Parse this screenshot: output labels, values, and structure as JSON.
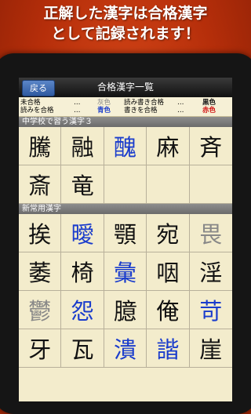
{
  "promo": {
    "line1": "正解した漢字は合格漢字",
    "line2": "として記録されます！"
  },
  "header": {
    "back_label": "戻る",
    "title": "合格漢字一覧"
  },
  "legend": [
    {
      "label": "未合格",
      "dots": "…",
      "color_name": "灰色",
      "color": "#888888"
    },
    {
      "label": "読み書き合格",
      "dots": "…",
      "color_name": "黒色",
      "color": "#111111"
    },
    {
      "label": "読みを合格",
      "dots": "…",
      "color_name": "青色",
      "color": "#1a3ccc"
    },
    {
      "label": "書きを合格",
      "dots": "…",
      "color_name": "赤色",
      "color": "#d01010"
    }
  ],
  "sections": [
    {
      "name": "中学校で習う漢字３",
      "kanji": [
        {
          "char": "騰",
          "color": "#111111"
        },
        {
          "char": "融",
          "color": "#111111"
        },
        {
          "char": "醜",
          "color": "#1a3ccc"
        },
        {
          "char": "麻",
          "color": "#111111"
        },
        {
          "char": "斉",
          "color": "#111111"
        },
        {
          "char": "斎",
          "color": "#111111"
        },
        {
          "char": "竜",
          "color": "#111111"
        }
      ]
    },
    {
      "name": "新常用漢字",
      "kanji": [
        {
          "char": "挨",
          "color": "#111111"
        },
        {
          "char": "曖",
          "color": "#1a3ccc"
        },
        {
          "char": "顎",
          "color": "#111111"
        },
        {
          "char": "宛",
          "color": "#111111"
        },
        {
          "char": "畏",
          "color": "#888888"
        },
        {
          "char": "萎",
          "color": "#111111"
        },
        {
          "char": "椅",
          "color": "#111111"
        },
        {
          "char": "彙",
          "color": "#1a3ccc"
        },
        {
          "char": "咽",
          "color": "#111111"
        },
        {
          "char": "淫",
          "color": "#111111"
        },
        {
          "char": "鬱",
          "color": "#888888"
        },
        {
          "char": "怨",
          "color": "#1a3ccc"
        },
        {
          "char": "臆",
          "color": "#111111"
        },
        {
          "char": "俺",
          "color": "#111111"
        },
        {
          "char": "苛",
          "color": "#1a3ccc"
        },
        {
          "char": "牙",
          "color": "#111111"
        },
        {
          "char": "瓦",
          "color": "#111111"
        },
        {
          "char": "潰",
          "color": "#1a3ccc"
        },
        {
          "char": "諧",
          "color": "#1a3ccc"
        },
        {
          "char": "崖",
          "color": "#111111"
        }
      ]
    }
  ]
}
